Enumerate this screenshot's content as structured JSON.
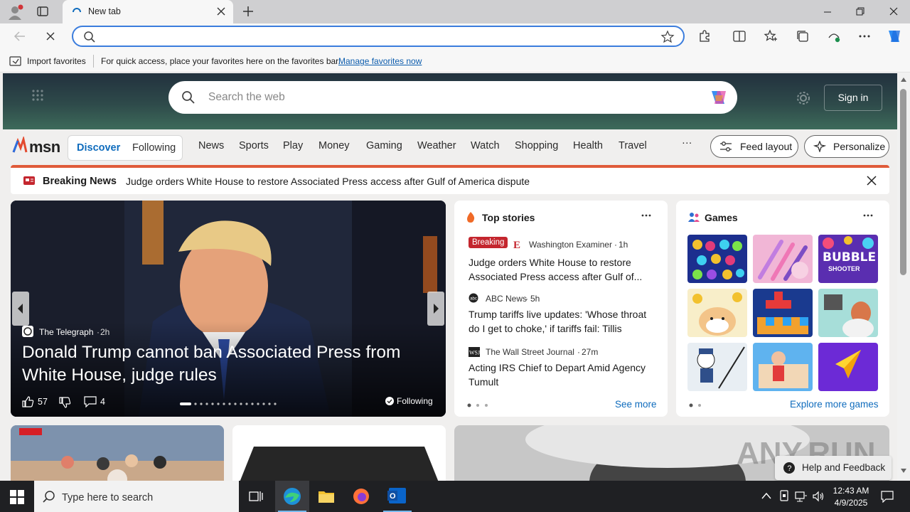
{
  "browser": {
    "tab_title": "New tab",
    "address_placeholder": "",
    "favbar": {
      "import_label": "Import favorites",
      "hint": "For quick access, place your favorites here on the favorites bar.",
      "manage_link": "Manage favorites now"
    }
  },
  "msn": {
    "logo": "msn",
    "search_placeholder": "Search the web",
    "sign_in": "Sign in",
    "tabs": [
      "Discover",
      "Following"
    ],
    "nav": [
      "News",
      "Sports",
      "Play",
      "Money",
      "Gaming",
      "Weather",
      "Watch",
      "Shopping",
      "Health",
      "Travel"
    ],
    "more": "···",
    "feed_layout": "Feed layout",
    "personalize": "Personalize",
    "breaking": {
      "label": "Breaking News",
      "text": "Judge orders White House to restore Associated Press access after Gulf of America dispute"
    },
    "hero": {
      "source": "The Telegraph",
      "age": "2h",
      "title": "Donald Trump cannot ban Associated Press from White House, judge rules",
      "likes": "57",
      "comments": "4",
      "following": "Following"
    },
    "top_stories": {
      "heading": "Top stories",
      "items": [
        {
          "badge": "Breaking",
          "source": "Washington Examiner",
          "age": "1h",
          "title": "Judge orders White House to restore Associated Press access after Gulf of..."
        },
        {
          "source": "ABC News",
          "age": "5h",
          "title": "Trump tariffs live updates: 'Whose throat do I get to choke,' if tariffs fail: Tillis"
        },
        {
          "source": "The Wall Street Journal",
          "age": "27m",
          "title": "Acting IRS Chief to Depart Amid Agency Tumult"
        }
      ],
      "see_more": "See more"
    },
    "games": {
      "heading": "Games",
      "bubble_line1": "BUBBLE",
      "bubble_line2": "SHOOTER",
      "explore": "Explore more games"
    },
    "watermark": "ANY.RUN",
    "help": "Help and Feedback"
  },
  "taskbar": {
    "search_placeholder": "Type here to search",
    "time": "12:43 AM",
    "date": "4/9/2025"
  },
  "colors": {
    "accent": "#0f6cbd",
    "breaking_red": "#c4262e",
    "taskbar": "#1f2023"
  }
}
